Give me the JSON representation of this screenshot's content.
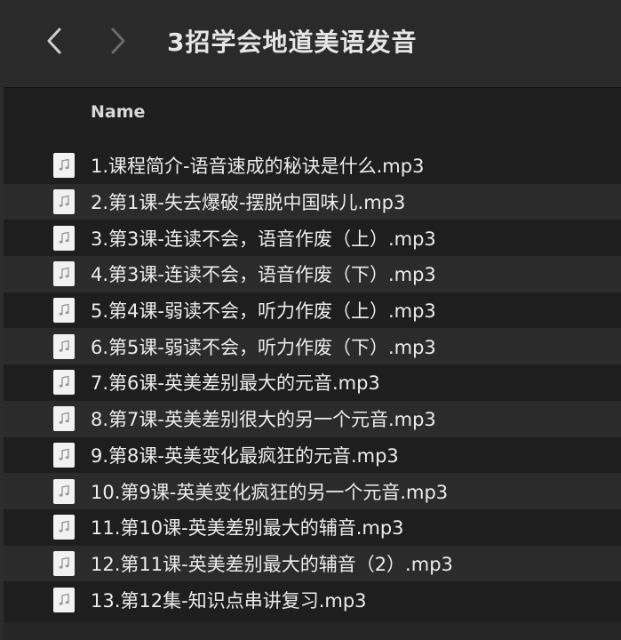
{
  "window": {
    "title": "3招学会地道美语发音"
  },
  "toolbar": {
    "back_icon": "chevron-left-icon",
    "forward_icon": "chevron-right-icon"
  },
  "list": {
    "column_name": "Name",
    "file_icon": "audio-file-icon",
    "items": [
      {
        "name": "1.课程简介-语音速成的秘诀是什么.mp3"
      },
      {
        "name": "2.第1课-失去爆破-摆脱中国味儿.mp3"
      },
      {
        "name": "3.第3课-连读不会，语音作废（上）.mp3"
      },
      {
        "name": "4.第3课-连读不会，语音作废（下）.mp3"
      },
      {
        "name": "5.第4课-弱读不会，听力作废（上）.mp3"
      },
      {
        "name": "6.第5课-弱读不会，听力作废（下）.mp3"
      },
      {
        "name": "7.第6课-英美差别最大的元音.mp3"
      },
      {
        "name": "8.第7课-英美差别很大的另一个元音.mp3"
      },
      {
        "name": "9.第8课-英美变化最疯狂的元音.mp3"
      },
      {
        "name": "10.第9课-英美变化疯狂的另一个元音.mp3"
      },
      {
        "name": "11.第10课-英美差别最大的辅音.mp3"
      },
      {
        "name": "12.第11课-英美差别最大的辅音（2）.mp3"
      },
      {
        "name": "13.第12集-知识点串讲复习.mp3"
      }
    ]
  },
  "colors": {
    "background": "#1e1e1e",
    "titlebar": "#2a2a2a",
    "row_alt": "#2b2b2b",
    "text": "#ececec"
  }
}
